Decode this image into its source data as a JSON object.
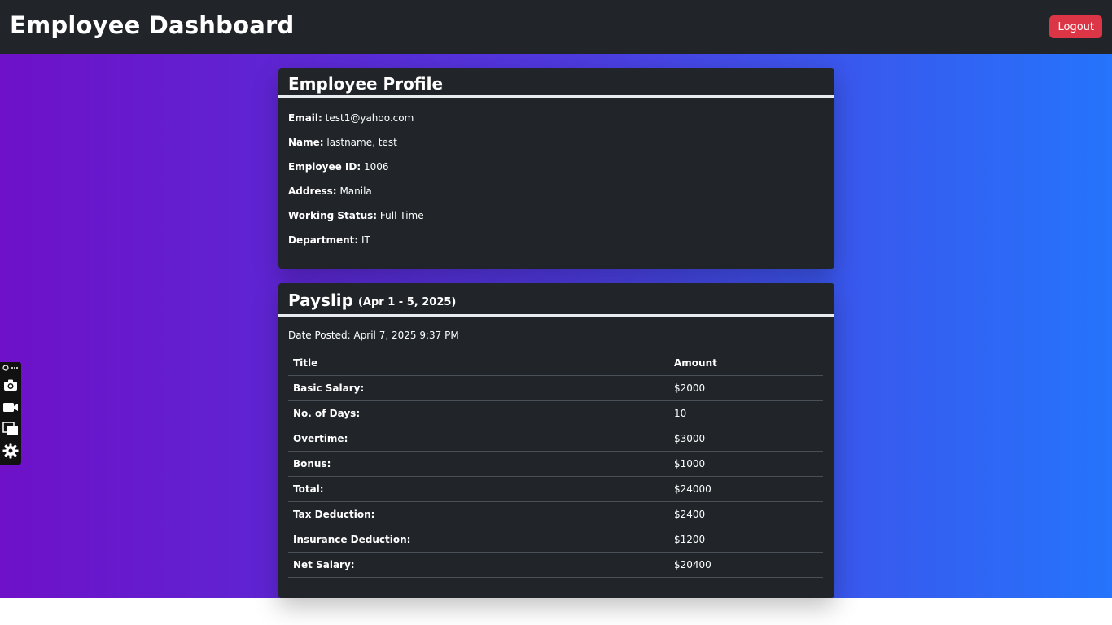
{
  "header": {
    "title": "Employee Dashboard",
    "logout_label": "Logout"
  },
  "profile": {
    "title": "Employee Profile",
    "fields": [
      {
        "label": "Email:",
        "value": "test1@yahoo.com"
      },
      {
        "label": "Name:",
        "value": "lastname, test"
      },
      {
        "label": "Employee ID:",
        "value": "1006"
      },
      {
        "label": "Address:",
        "value": "Manila"
      },
      {
        "label": "Working Status:",
        "value": "Full Time"
      },
      {
        "label": "Department:",
        "value": "IT"
      }
    ]
  },
  "payslip": {
    "title": "Payslip",
    "period": "(Apr 1 - 5, 2025)",
    "date_posted": "Date Posted: April 7, 2025 9:37 PM",
    "columns": [
      "Title",
      "Amount"
    ],
    "rows": [
      {
        "title": "Basic Salary:",
        "amount": "$2000"
      },
      {
        "title": "No. of Days:",
        "amount": "10"
      },
      {
        "title": "Overtime:",
        "amount": "$3000"
      },
      {
        "title": "Bonus:",
        "amount": "$1000"
      },
      {
        "title": "Total:",
        "amount": "$24000"
      },
      {
        "title": "Tax Deduction:",
        "amount": "$2400"
      },
      {
        "title": "Insurance Deduction:",
        "amount": "$1200"
      },
      {
        "title": "Net Salary:",
        "amount": "$20400"
      }
    ]
  },
  "side_toolbar": {
    "top_glyph": "⚙ ···",
    "icons": [
      "camera-icon",
      "video-camera-icon",
      "copy-icon",
      "gear-icon"
    ]
  },
  "colors": {
    "topbar": "#212529",
    "card": "#212529",
    "logout": "#dc3545",
    "gradient_start": "#6e11c8",
    "gradient_end": "#2574fb"
  }
}
